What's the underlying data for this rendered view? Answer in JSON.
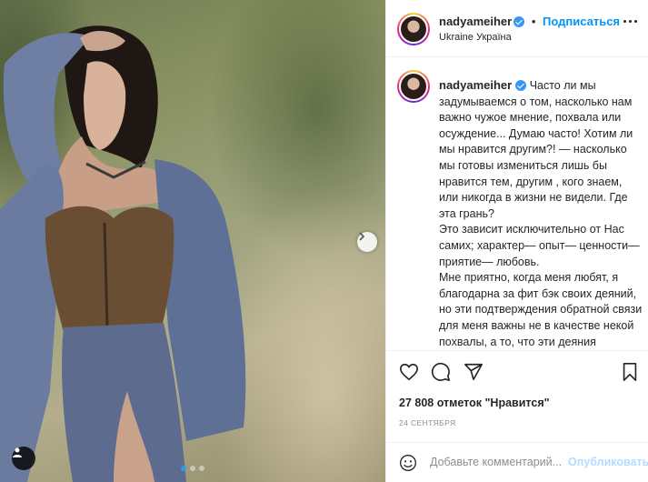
{
  "post": {
    "username": "nadyameiher",
    "verified": true,
    "follow_label": "Подписаться",
    "separator": "•",
    "location": "Ukraine Україна",
    "caption": "Часто ли мы задумываемся о том, насколько нам важно чужое мнение, похвала или осуждение... Думаю часто! Хотим ли мы нравится другим?! — насколько мы готовы измениться лишь бы нравится тем, другим , кого знаем, или никогда в жизни не видели. Где эта грань?\nЭто зависит исключительно от Нас самих; характер— опыт— ценности— приятие— любовь.\nМне приятно, когда меня любят, я благодарна за фит бэк своих деяний, но эти подтверждения обратной связи для меня важны не в качестве некой похвалы, а то, что эти деяния принесли пользу другой стороне в малом или большом. Вот что мне важно!\nИ тем более не трогает чья-то обида на меня. Жизнь утекающее движее",
    "likes": "27 808 отметок \"Нравится\"",
    "date": "24 сентября"
  },
  "carousel": {
    "slide_count": 3,
    "active_index": 0
  },
  "comment": {
    "placeholder": "Добавьте комментарий...",
    "publish_label": "Опубликовать"
  },
  "colors": {
    "accent": "#0095f6",
    "verified": "#3897f0",
    "publish_disabled": "#b3dbff",
    "muted": "#8e8e8e"
  },
  "icons": [
    "heart-icon",
    "comment-icon",
    "share-icon",
    "bookmark-icon",
    "emoji-icon",
    "more-icon",
    "chevron-right-icon",
    "user-tag-icon",
    "verified-icon"
  ]
}
